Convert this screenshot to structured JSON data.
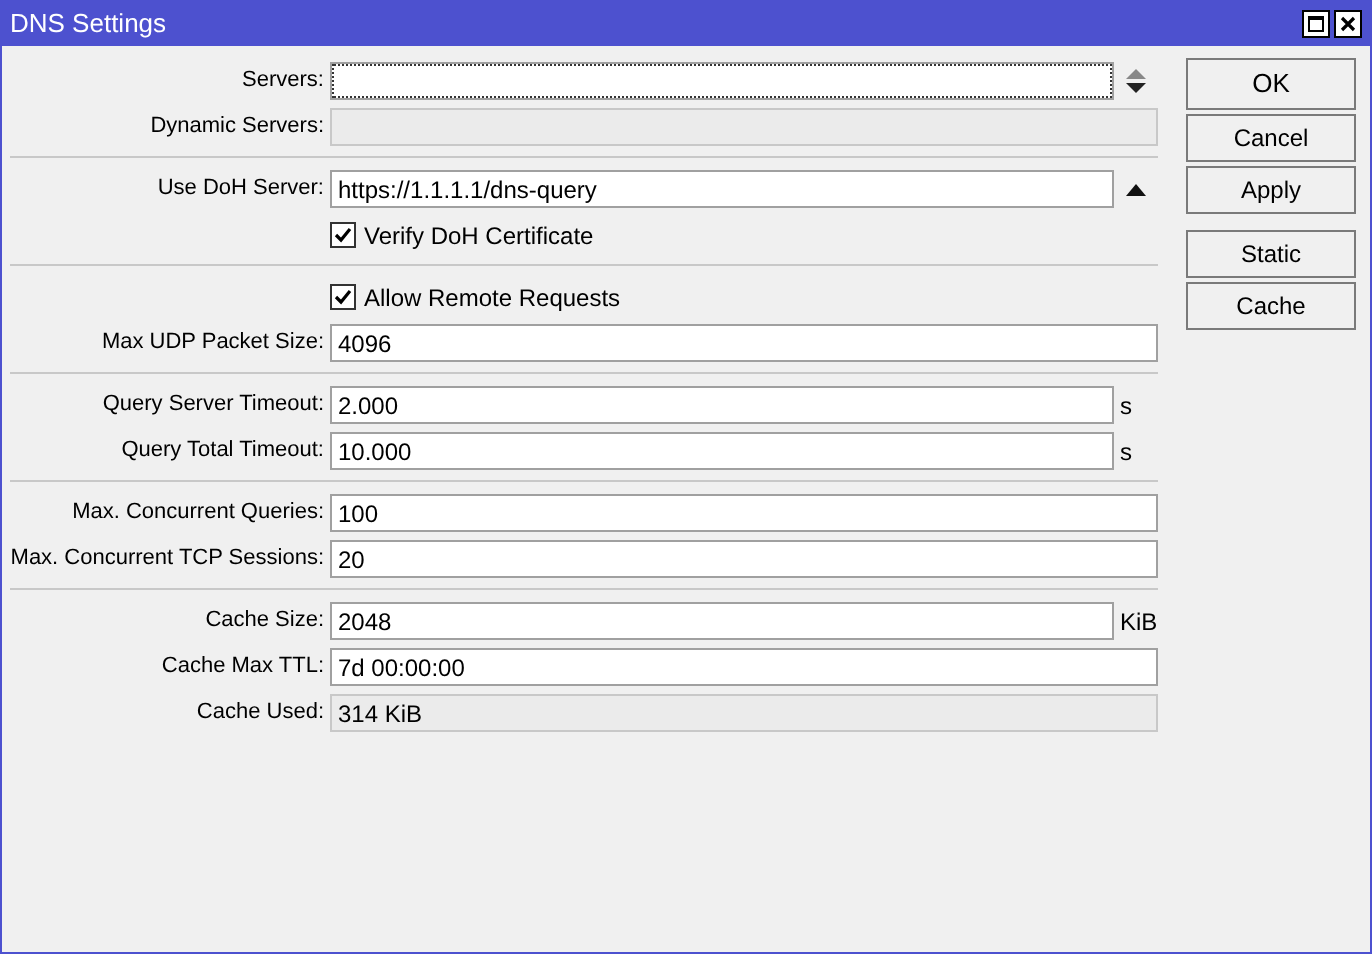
{
  "window": {
    "title": "DNS Settings"
  },
  "groups": [
    {
      "rows": [
        {
          "kind": "field",
          "label": "Servers:",
          "value": "",
          "disabled": false,
          "focused": true,
          "spinner": true,
          "collapse_arrow": false
        },
        {
          "kind": "field",
          "label": "Dynamic Servers:",
          "value": "",
          "disabled": true,
          "focused": false,
          "spinner": false,
          "collapse_arrow": false
        }
      ]
    },
    {
      "rows": [
        {
          "kind": "field",
          "label": "Use DoH Server:",
          "value": "https://1.1.1.1/dns-query",
          "disabled": false,
          "focused": false,
          "spinner": false,
          "collapse_arrow": true
        },
        {
          "kind": "checkbox",
          "label": "Verify DoH Certificate",
          "checked": true
        }
      ]
    },
    {
      "rows": [
        {
          "kind": "checkbox",
          "label": "Allow Remote Requests",
          "checked": true
        },
        {
          "kind": "field",
          "label": "Max UDP Packet Size:",
          "value": "4096",
          "disabled": false,
          "focused": false,
          "spinner": false,
          "collapse_arrow": false
        }
      ]
    },
    {
      "rows": [
        {
          "kind": "field",
          "label": "Query Server Timeout:",
          "value": "2.000",
          "disabled": false,
          "focused": false,
          "spinner": false,
          "collapse_arrow": false,
          "unit": "s"
        },
        {
          "kind": "field",
          "label": "Query Total Timeout:",
          "value": "10.000",
          "disabled": false,
          "focused": false,
          "spinner": false,
          "collapse_arrow": false,
          "unit": "s"
        }
      ]
    },
    {
      "rows": [
        {
          "kind": "field",
          "label": "Max. Concurrent Queries:",
          "value": "100",
          "disabled": false,
          "focused": false,
          "spinner": false,
          "collapse_arrow": false
        },
        {
          "kind": "field",
          "label": "Max. Concurrent TCP Sessions:",
          "value": "20",
          "disabled": false,
          "focused": false,
          "spinner": false,
          "collapse_arrow": false
        }
      ]
    },
    {
      "rows": [
        {
          "kind": "field",
          "label": "Cache Size:",
          "value": "2048",
          "disabled": false,
          "focused": false,
          "spinner": false,
          "collapse_arrow": false,
          "unit": "KiB"
        },
        {
          "kind": "field",
          "label": "Cache Max TTL:",
          "value": "7d 00:00:00",
          "disabled": false,
          "focused": false,
          "spinner": false,
          "collapse_arrow": false
        },
        {
          "kind": "field",
          "label": "Cache Used:",
          "value": "314 KiB",
          "disabled": true,
          "focused": false,
          "spinner": false,
          "collapse_arrow": false
        }
      ]
    }
  ],
  "button_groups": [
    [
      "OK",
      "Cancel",
      "Apply"
    ],
    [
      "Static",
      "Cache"
    ]
  ]
}
